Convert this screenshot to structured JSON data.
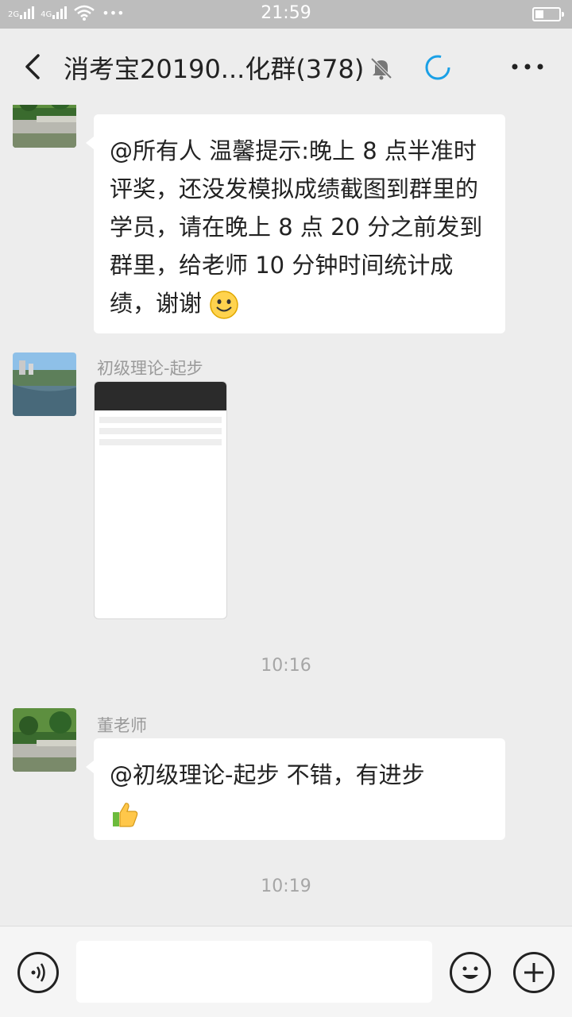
{
  "status_bar": {
    "time": "21:59",
    "signal_1": "2G",
    "signal_2": "4G",
    "more_dots": "•••",
    "battery_level": 0.35
  },
  "header": {
    "title": "消考宝20190...化群(378)",
    "icons": [
      "back-arrow-icon",
      "mute-bell-icon",
      "loading-spinner-icon",
      "more-icon"
    ],
    "accent_color": "#1aa0e6"
  },
  "messages": [
    {
      "sender": "",
      "text": "@所有人  温馨提示:晚上 8 点半准时评奖，还没发模拟成绩截图到群里的学员，请在晚上 8 点 20 分之前发到群里，给老师 10 分钟时间统计成绩，谢谢",
      "emoji": "smile-emoji-icon"
    },
    {
      "sender": "初级理论-起步",
      "type": "image"
    },
    {
      "timestamp": "10:16"
    },
    {
      "sender": "董老师",
      "text": "@初级理论-起步   不错，有进步",
      "emoji": "thumbs-up-emoji-icon"
    },
    {
      "timestamp": "10:19"
    }
  ],
  "input_bar": {
    "icons": [
      "voice-icon",
      "emoji-icon",
      "plus-icon"
    ],
    "value": ""
  }
}
